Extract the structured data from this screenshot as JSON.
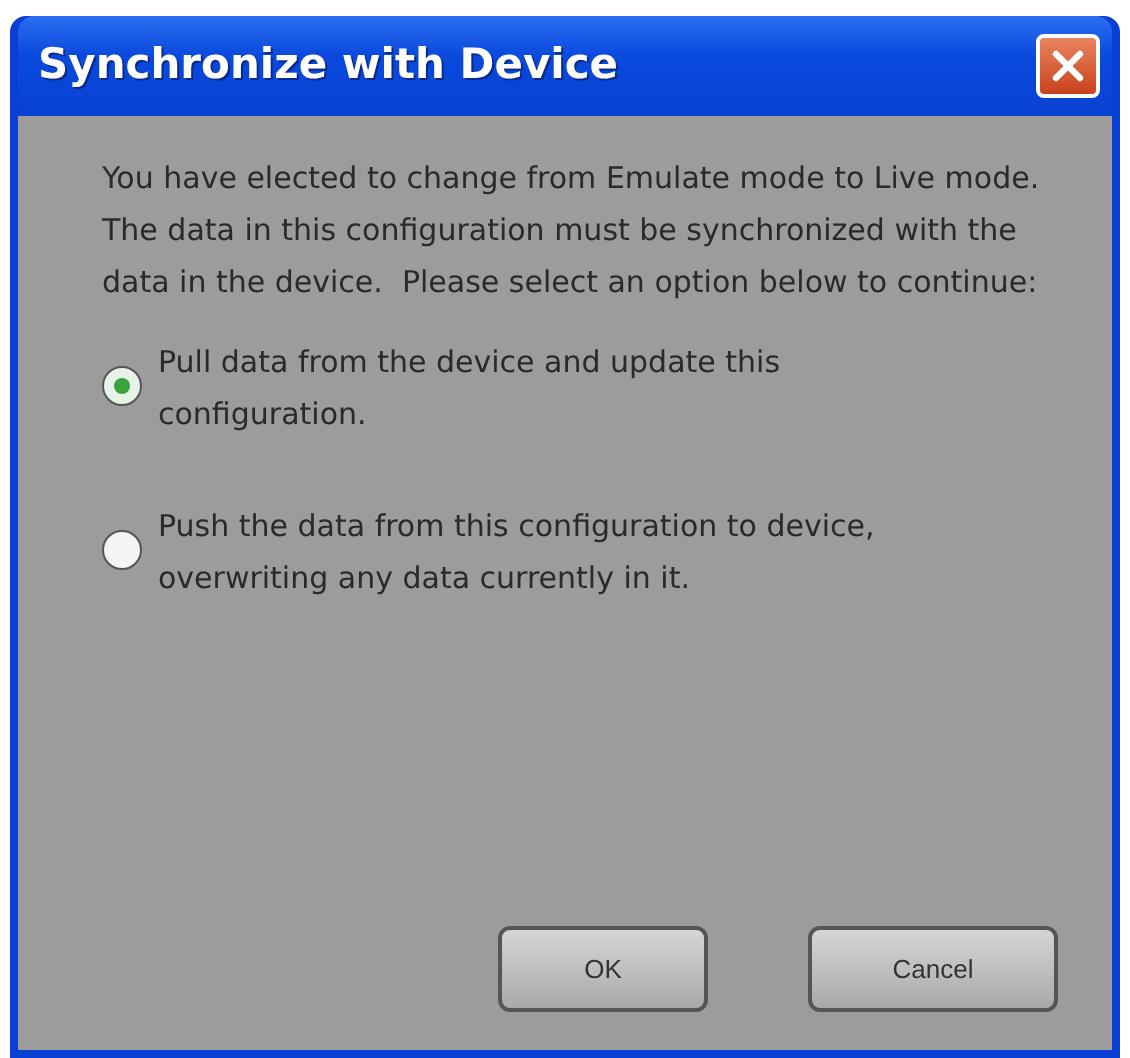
{
  "window": {
    "title": "Synchronize with Device"
  },
  "message": "You have elected to change from Emulate mode to Live mode.  The data in this configuration must be synchronized with the data in the device.  Please select an option below to continue:",
  "options": [
    {
      "label": "Pull data from the device and update this configuration.",
      "selected": true
    },
    {
      "label": "Push the data from this configuration to device, overwriting any data currently in it.",
      "selected": false
    }
  ],
  "buttons": [
    {
      "label": "OK"
    },
    {
      "label": "Cancel"
    }
  ]
}
